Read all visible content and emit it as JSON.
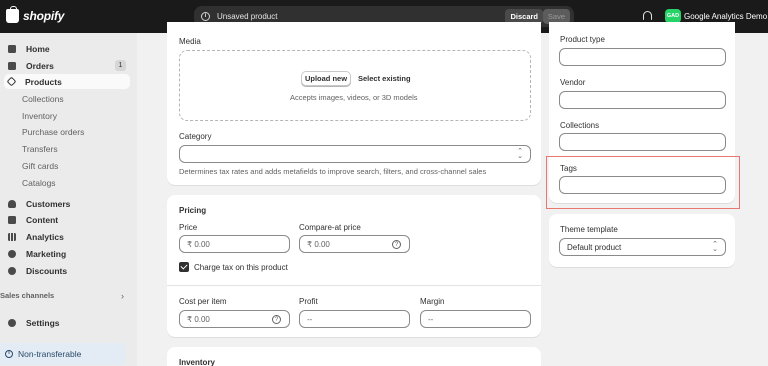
{
  "topbar": {
    "brand": "shopify",
    "unsaved_text": "Unsaved product",
    "discard_label": "Discard",
    "save_label": "Save",
    "store_initials": "GAD",
    "store_name": "Google Analytics Demo"
  },
  "sidebar": {
    "home": "Home",
    "orders": "Orders",
    "orders_badge": "1",
    "products": "Products",
    "product_subitems": [
      "Collections",
      "Inventory",
      "Purchase orders",
      "Transfers",
      "Gift cards",
      "Catalogs"
    ],
    "customers": "Customers",
    "content": "Content",
    "analytics": "Analytics",
    "marketing": "Marketing",
    "discounts": "Discounts",
    "sales_channels": "Sales channels",
    "settings": "Settings",
    "non_transferable": "Non-transferable"
  },
  "media": {
    "label": "Media",
    "upload_label": "Upload new",
    "select_existing_label": "Select existing",
    "accepts_text": "Accepts images, videos, or 3D models"
  },
  "category": {
    "label": "Category",
    "hint": "Determines tax rates and adds metafields to improve search, filters, and cross-channel sales"
  },
  "pricing": {
    "title": "Pricing",
    "price_label": "Price",
    "price_value": "₹ 0.00",
    "compare_label": "Compare-at price",
    "compare_value": "₹ 0.00",
    "charge_tax_label": "Charge tax on this product",
    "cost_label": "Cost per item",
    "cost_value": "₹ 0.00",
    "profit_label": "Profit",
    "profit_value": "--",
    "margin_label": "Margin",
    "margin_value": "--"
  },
  "inventory": {
    "title": "Inventory"
  },
  "organization": {
    "product_type_label": "Product type",
    "vendor_label": "Vendor",
    "collections_label": "Collections",
    "tags_label": "Tags"
  },
  "theme": {
    "label": "Theme template",
    "value": "Default product"
  }
}
